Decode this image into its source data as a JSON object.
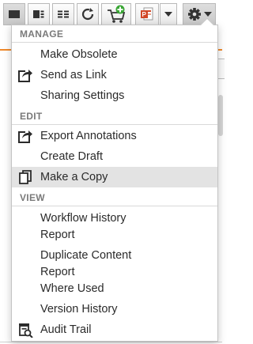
{
  "toolbar": {
    "buttons": [
      {
        "icon": "single-pane-view-icon",
        "active": true
      },
      {
        "icon": "split-pane-view-icon",
        "active": false
      },
      {
        "icon": "list-view-icon",
        "active": false
      },
      {
        "icon": "refresh-icon",
        "active": false
      },
      {
        "icon": "add-to-cart-icon",
        "active": false
      },
      {
        "icon": "powerpoint-export-icon",
        "active": false
      },
      {
        "icon": "dropdown-caret-icon",
        "active": false
      },
      {
        "icon": "gear-icon",
        "active": true
      }
    ]
  },
  "menu": {
    "sections": {
      "manage": "MANAGE",
      "edit": "EDIT",
      "view": "VIEW"
    },
    "items": {
      "make_obsolete": "Make Obsolete",
      "send_as_link": "Send as Link",
      "sharing_settings": "Sharing Settings",
      "export_annotations": "Export Annotations",
      "create_draft": "Create Draft",
      "make_a_copy": "Make a Copy",
      "workflow_history_1": "Workflow History",
      "workflow_history_2": "Report",
      "duplicate_content_1": "Duplicate Content",
      "duplicate_content_2": "Report",
      "where_used": "Where Used",
      "version_history": "Version History",
      "audit_trail": "Audit Trail"
    },
    "highlighted_item": "make_a_copy"
  },
  "colors": {
    "accent_orange": "#f08a2c",
    "highlight": "#e3e3e3",
    "section_text": "#7a7a7a",
    "powerpoint_red": "#d24726",
    "cart_green": "#3aa635"
  }
}
